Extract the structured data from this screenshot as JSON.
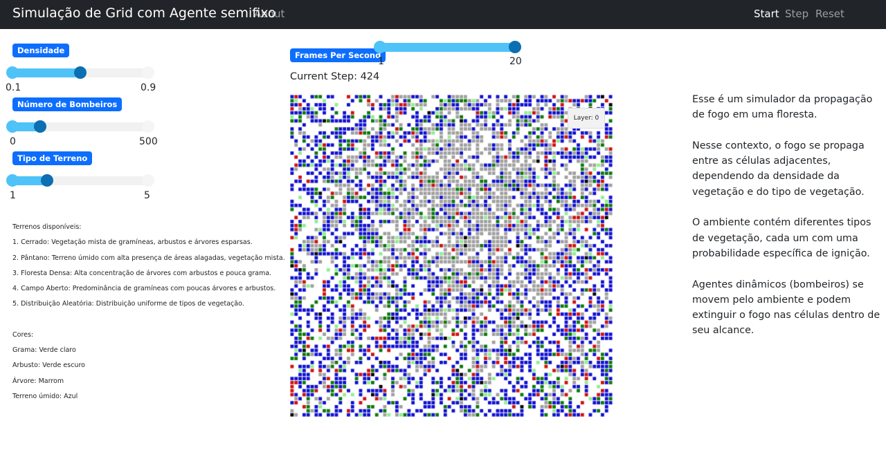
{
  "navbar": {
    "title": "Simulação de Grid com Agente semifixo",
    "about": "About",
    "start": "Start",
    "step": "Step",
    "reset": "Reset"
  },
  "sliders": {
    "density": {
      "label": "Densidade",
      "min_label": "0.1",
      "max_label": "0.9",
      "min": 0.1,
      "max": 0.9,
      "value": 0.5
    },
    "firefighters": {
      "label": "Número de Bombeiros",
      "min_label": "0",
      "max_label": "500",
      "min": 0,
      "max": 500,
      "value": 100
    },
    "terrain": {
      "label": "Tipo de Terreno",
      "min_label": "1",
      "max_label": "5",
      "min": 1,
      "max": 5,
      "value": 2
    },
    "fps": {
      "label": "Frames Per Second",
      "min_label": "1",
      "max_label": "20",
      "min": 1,
      "max": 20,
      "value": 20
    }
  },
  "current_step": "Current Step: 424",
  "layer_label": "Layer: 0",
  "legend": {
    "terrains_title": "Terrenos disponíveis:",
    "terrains": [
      "1. Cerrado: Vegetação mista de gramíneas, arbustos e árvores esparsas.",
      "2. Pântano: Terreno úmido com alta presença de áreas alagadas, vegetação mista.",
      "3. Floresta Densa: Alta concentração de árvores com arbustos e pouca grama.",
      "4. Campo Aberto: Predominância de gramíneas com poucas árvores e arbustos.",
      "5. Distribuição Aleatória: Distribuição uniforme de tipos de vegetação."
    ],
    "colors_title": "Cores:",
    "colors": [
      "Grama: Verde claro",
      "Arbusto: Verde escuro",
      "Árvore: Marrom",
      "Terreno úmido: Azul"
    ]
  },
  "description": [
    "Esse é um simulador da propagação de fogo em uma floresta.",
    "Nesse contexto, o fogo se propaga entre as células adjacentes, dependendo da densidade da vegetação e do tipo de vegetação.",
    "O ambiente contém diferentes tipos de vegetação, cada um com uma probabilidade específica de ignição.",
    "Agentes dinâmicos (bombeiros) se movem pelo ambiente e podem extinguir o fogo nas células dentro de seu alcance."
  ],
  "grid_colors": {
    "empty": "#ffffff",
    "burned": "#a0a0a0",
    "wet": "#1010d0",
    "shrub": "#0a7a0a",
    "grass": "#90ee90",
    "fire": "#d01010",
    "firefighter": "#000000"
  }
}
